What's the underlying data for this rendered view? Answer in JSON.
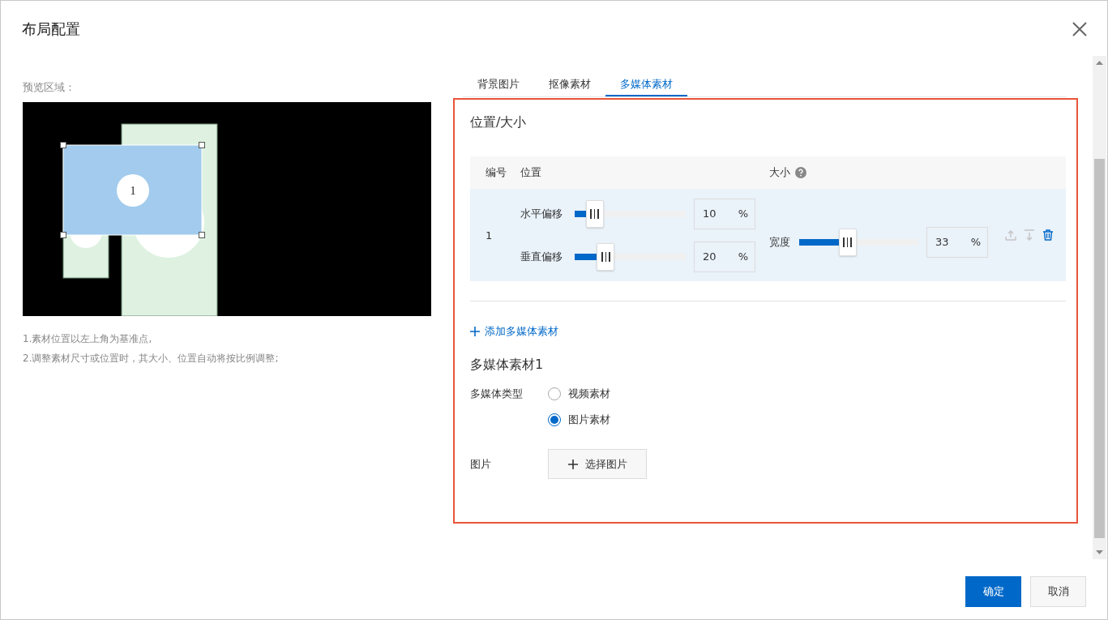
{
  "window": {
    "title": "布局配置"
  },
  "preview": {
    "label": "预览区域：",
    "region_number": "1"
  },
  "notes": [
    "1.素材位置以左上角为基准点,",
    "2.调整素材尺寸或位置时，其大小、位置自动将按比例调整;"
  ],
  "tabs": [
    {
      "label": "背景图片",
      "selected": false
    },
    {
      "label": "抠像素材",
      "selected": false
    },
    {
      "label": "多媒体素材",
      "selected": true
    }
  ],
  "section_title": "位置/大小",
  "table": {
    "columns": [
      "编号",
      "位置",
      "大小"
    ],
    "rows": [
      {
        "number": "1",
        "position": [
          {
            "label": "水平偏移",
            "level": 0.1,
            "value": "10",
            "unit": "%"
          },
          {
            "label": "垂直偏移",
            "level": 0.2,
            "value": "20",
            "unit": "%"
          }
        ],
        "size": [
          {
            "label": "宽度",
            "level": 0.33,
            "value": "33",
            "unit": "%"
          }
        ],
        "actions": [
          {
            "kind": "move-up",
            "disabled": true
          },
          {
            "kind": "move-down",
            "disabled": true
          },
          {
            "kind": "delete",
            "disabled": false
          }
        ]
      }
    ]
  },
  "add_link": "添加多媒体素材",
  "item": {
    "title": "多媒体素材1",
    "type_label": "多媒体类型",
    "options": [
      {
        "label": "视频素材",
        "selected": false
      },
      {
        "label": "图片素材",
        "selected": true
      }
    ],
    "image_label": "图片",
    "choose_button": "选择图片"
  },
  "buttons": [
    {
      "label": "确定",
      "kind": "primary"
    },
    {
      "label": "取消",
      "kind": "secondary"
    }
  ]
}
